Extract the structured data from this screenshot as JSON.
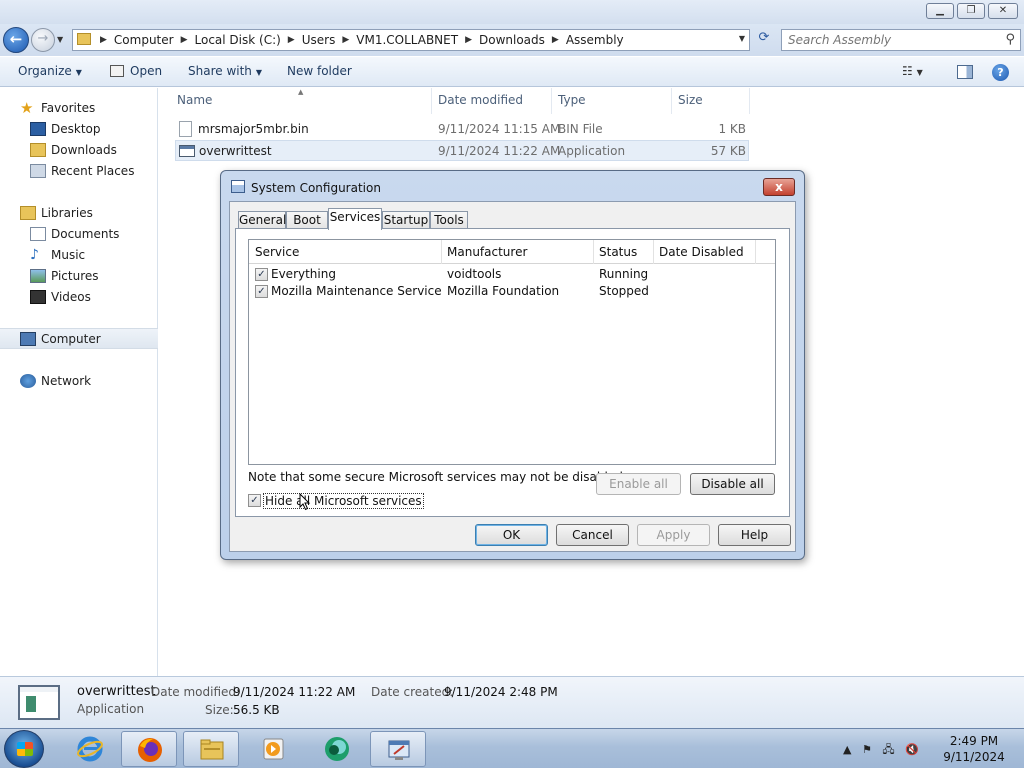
{
  "explorer": {
    "breadcrumb": [
      "Computer",
      "Local Disk (C:)",
      "Users",
      "VM1.COLLABNET",
      "Downloads",
      "Assembly"
    ],
    "search_placeholder": "Search Assembly",
    "toolbar": {
      "organize": "Organize",
      "open": "Open",
      "share_with": "Share with",
      "new_folder": "New folder"
    },
    "nav": {
      "favorites": "Favorites",
      "desktop": "Desktop",
      "downloads": "Downloads",
      "recent_places": "Recent Places",
      "libraries": "Libraries",
      "documents": "Documents",
      "music": "Music",
      "pictures": "Pictures",
      "videos": "Videos",
      "computer": "Computer",
      "network": "Network"
    },
    "columns": {
      "name": "Name",
      "date_modified": "Date modified",
      "type": "Type",
      "size": "Size"
    },
    "files": [
      {
        "name": "mrsmajor5mbr.bin",
        "date": "9/11/2024 11:15 AM",
        "type": "BIN File",
        "size": "1 KB"
      },
      {
        "name": "overwrittest",
        "date": "9/11/2024 11:22 AM",
        "type": "Application",
        "size": "57 KB"
      }
    ],
    "details": {
      "name": "overwrittest",
      "type": "Application",
      "date_modified_label": "Date modified:",
      "date_modified": "9/11/2024 11:22 AM",
      "date_created_label": "Date created:",
      "date_created": "9/11/2024 2:48 PM",
      "size_label": "Size:",
      "size": "56.5 KB"
    }
  },
  "dialog": {
    "title": "System Configuration",
    "close_label": "x",
    "tabs": [
      "General",
      "Boot",
      "Services",
      "Startup",
      "Tools"
    ],
    "active_tab": "Services",
    "columns": {
      "service": "Service",
      "manufacturer": "Manufacturer",
      "status": "Status",
      "date_disabled": "Date Disabled"
    },
    "services": [
      {
        "name": "Everything",
        "manufacturer": "voidtools",
        "status": "Running",
        "date_disabled": "",
        "checked": true
      },
      {
        "name": "Mozilla Maintenance Service",
        "manufacturer": "Mozilla Foundation",
        "status": "Stopped",
        "date_disabled": "",
        "checked": true
      }
    ],
    "note": "Note that some secure Microsoft services may not be disabled.",
    "enable_all": "Enable all",
    "disable_all": "Disable all",
    "hide_ms_label": "Hide all Microsoft services",
    "hide_ms_checked": true,
    "ok": "OK",
    "cancel": "Cancel",
    "apply": "Apply",
    "help": "Help"
  },
  "taskbar": {
    "time": "2:49 PM",
    "date": "9/11/2024"
  }
}
